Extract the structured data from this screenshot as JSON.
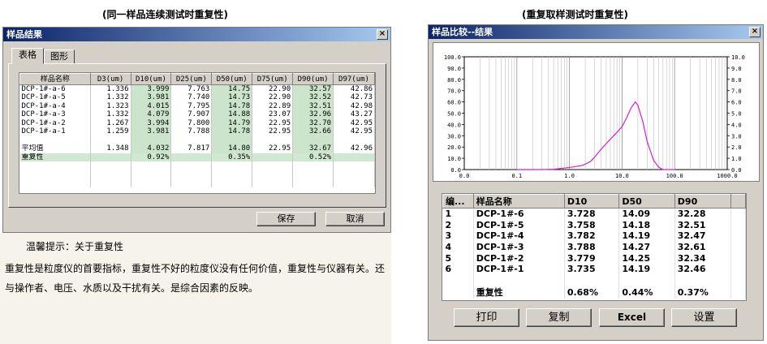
{
  "captions": {
    "left": "(同一样品连续测试时重复性)",
    "right": "(重复取样测试时重复性)"
  },
  "left_window": {
    "title": "样品结果",
    "close": "×",
    "tabs": [
      {
        "label": "表格"
      },
      {
        "label": "图形"
      }
    ],
    "columns": [
      "样品名称",
      "D3(um)",
      "D10(um)",
      "D25(um)",
      "D50(um)",
      "D75(um)",
      "D90(um)",
      "D97(um)"
    ],
    "rows": [
      [
        "DCP-1#-a-6",
        "1.336",
        "3.999",
        "7.763",
        "14.75",
        "22.90",
        "32.57",
        "42.86"
      ],
      [
        "DCP-1#-a-5",
        "1.332",
        "3.981",
        "7.740",
        "14.73",
        "22.90",
        "32.52",
        "42.73"
      ],
      [
        "DCP-1#-a-4",
        "1.323",
        "4.015",
        "7.795",
        "14.78",
        "22.89",
        "32.51",
        "42.98"
      ],
      [
        "DCP-1#-a-3",
        "1.332",
        "4.079",
        "7.907",
        "14.88",
        "23.07",
        "32.96",
        "43.27"
      ],
      [
        "DCP-1#-a-2",
        "1.267",
        "3.994",
        "7.800",
        "14.79",
        "22.95",
        "32.70",
        "42.95"
      ],
      [
        "DCP-1#-a-1",
        "1.259",
        "3.981",
        "7.788",
        "14.78",
        "22.95",
        "32.66",
        "42.95"
      ]
    ],
    "average": [
      "平均值",
      "1.348",
      "4.032",
      "7.817",
      "14.80",
      "22.95",
      "32.67",
      "42.96"
    ],
    "repeat": [
      "重复性",
      "",
      "0.92%",
      "",
      "0.35%",
      "",
      "0.52%",
      ""
    ],
    "buttons": {
      "save": "保存",
      "cancel": "取消"
    }
  },
  "note": {
    "title": "温馨提示：关于重复性",
    "body": "重复性是粒度仪的首要指标，重复性不好的粒度仪没有任何价值，重复性与仪器有关。还与操作者、电压、水质以及干扰有关。是综合因素的反映。"
  },
  "right_window": {
    "title": "样品比较--结果",
    "close": "×",
    "columns": [
      "编...",
      "样品名称",
      "D10",
      "D50",
      "D90"
    ],
    "rows": [
      [
        "1",
        "DCP-1#-6",
        "3.728",
        "14.09",
        "32.28"
      ],
      [
        "2",
        "DCP-1#-5",
        "3.758",
        "14.18",
        "32.51"
      ],
      [
        "3",
        "DCP-1#-4",
        "3.782",
        "14.19",
        "32.47"
      ],
      [
        "4",
        "DCP-1#-3",
        "3.788",
        "14.27",
        "32.61"
      ],
      [
        "5",
        "DCP-1#-2",
        "3.779",
        "14.25",
        "32.34"
      ],
      [
        "6",
        "DCP-1#-1",
        "3.735",
        "14.19",
        "32.46"
      ]
    ],
    "repeat": [
      "",
      "重复性",
      "0.68%",
      "0.44%",
      "0.37%"
    ],
    "buttons": {
      "print": "打印",
      "copy": "复制",
      "excel": "Excel",
      "settings": "设置"
    }
  },
  "chart_data": {
    "type": "line",
    "x_scale": "log",
    "xlim": [
      0.01,
      1000
    ],
    "x_ticks": [
      "0.0",
      "0.1",
      "1.0",
      "10.0",
      "100.0",
      "1000.0"
    ],
    "y_left_ticks": [
      "100.0",
      "90.0",
      "80.0",
      "70.0",
      "60.0",
      "50.0",
      "40.0",
      "30.0",
      "20.0",
      "10.0",
      "0.0"
    ],
    "y_right_ticks": [
      "10.0",
      "9.0",
      "8.0",
      "7.0",
      "6.0",
      "5.0",
      "4.0",
      "3.0",
      "2.0",
      "1.0",
      "0.0"
    ],
    "ylim": [
      0,
      100
    ],
    "grid": true,
    "series": [
      {
        "color": "#d020d0",
        "points": [
          [
            0.1,
            0
          ],
          [
            0.3,
            0
          ],
          [
            0.5,
            0.3
          ],
          [
            0.8,
            1.3
          ],
          [
            1.2,
            2.3
          ],
          [
            1.8,
            3.8
          ],
          [
            2.5,
            7
          ],
          [
            3,
            11
          ],
          [
            4,
            18
          ],
          [
            5,
            23
          ],
          [
            6,
            27
          ],
          [
            8,
            33
          ],
          [
            10,
            38
          ],
          [
            12,
            45
          ],
          [
            15,
            55
          ],
          [
            18,
            60
          ],
          [
            20,
            57
          ],
          [
            25,
            42
          ],
          [
            30,
            25
          ],
          [
            40,
            8
          ],
          [
            50,
            2
          ],
          [
            60,
            0
          ],
          [
            100,
            0
          ]
        ]
      }
    ]
  }
}
